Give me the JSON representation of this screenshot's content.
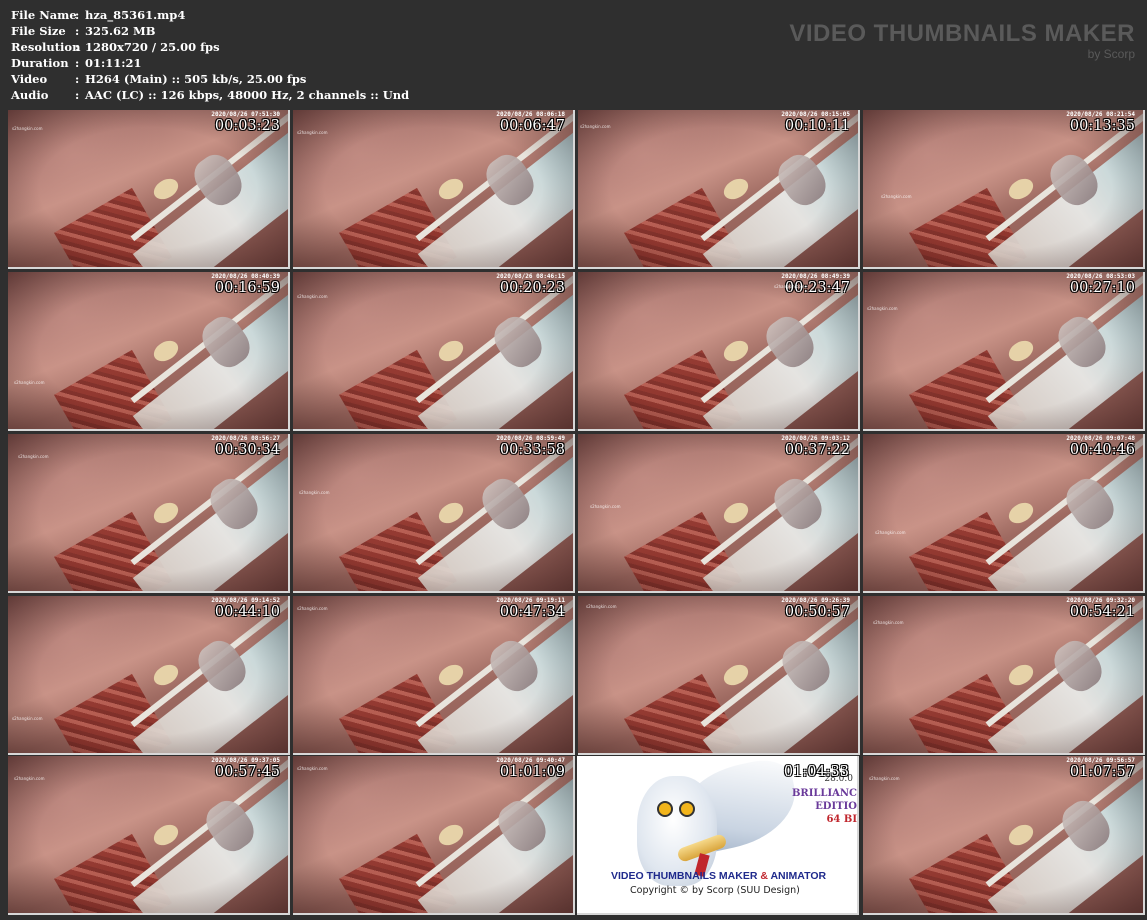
{
  "info": {
    "rows": [
      {
        "key": "File Name",
        "value": "hza_85361.mp4"
      },
      {
        "key": "File Size",
        "value": "325.62 MB"
      },
      {
        "key": "Resolution",
        "value": "1280x720 / 25.00 fps"
      },
      {
        "key": "Duration",
        "value": "01:11:21"
      },
      {
        "key": "Video",
        "value": "H264 (Main) :: 505 kb/s, 25.00 fps"
      },
      {
        "key": "Audio",
        "value": "AAC (LC) :: 126 kbps, 48000 Hz, 2 channels :: Und"
      }
    ],
    "separator": ":"
  },
  "brand": {
    "title": "VIDEO THUMBNAILS MAKER",
    "subtitle": "by Scorp"
  },
  "thumbnails": [
    {
      "timecode": "00:03:23",
      "stamp": "2020/08/26 07:51:30"
    },
    {
      "timecode": "00:06:47",
      "stamp": "2020/08/26 08:06:18"
    },
    {
      "timecode": "00:10:11",
      "stamp": "2020/08/26 08:15:05"
    },
    {
      "timecode": "00:13:35",
      "stamp": "2020/08/26 08:21:54"
    },
    {
      "timecode": "00:16:59",
      "stamp": "2020/08/26 08:40:39"
    },
    {
      "timecode": "00:20:23",
      "stamp": "2020/08/26 08:46:15"
    },
    {
      "timecode": "00:23:47",
      "stamp": "2020/08/26 08:49:39"
    },
    {
      "timecode": "00:27:10",
      "stamp": "2020/08/26 08:53:03"
    },
    {
      "timecode": "00:30:34",
      "stamp": "2020/08/26 08:56:27"
    },
    {
      "timecode": "00:33:58",
      "stamp": "2020/08/26 08:59:49"
    },
    {
      "timecode": "00:37:22",
      "stamp": "2020/08/26 09:03:12"
    },
    {
      "timecode": "00:40:46",
      "stamp": "2020/08/26 09:07:48"
    },
    {
      "timecode": "00:44:10",
      "stamp": "2020/08/26 09:14:52"
    },
    {
      "timecode": "00:47:34",
      "stamp": "2020/08/26 09:19:11"
    },
    {
      "timecode": "00:50:57",
      "stamp": "2020/08/26 09:26:39"
    },
    {
      "timecode": "00:54:21",
      "stamp": "2020/08/26 09:32:20"
    },
    {
      "timecode": "00:57:45",
      "stamp": "2020/08/26 09:37:05"
    },
    {
      "timecode": "01:01:09",
      "stamp": "2020/08/26 09:40:47"
    },
    {
      "timecode": "01:04:33",
      "stamp": "",
      "ad": true
    },
    {
      "timecode": "01:07:57",
      "stamp": "2020/08/26 09:56:57"
    }
  ],
  "ad": {
    "version": "28.0.0",
    "line1": "BRILLIANC",
    "line2": "EDITIO",
    "line3": "64 BI",
    "title_a": "VIDEO THUMBNAILS MAKER ",
    "title_amp": "&",
    "title_b": " ANIMATOR",
    "copyright": "Copyright © by Scorp (SUU Design)"
  },
  "watermark": "s2hangkin.com",
  "colors": {
    "background": "#2f2f2f",
    "text": "#ffffff",
    "brand": "#5a5a5a",
    "ad_title": "#1f2a8c",
    "ad_accent": "#c0262d",
    "ad_edition": "#6a3a9a"
  }
}
